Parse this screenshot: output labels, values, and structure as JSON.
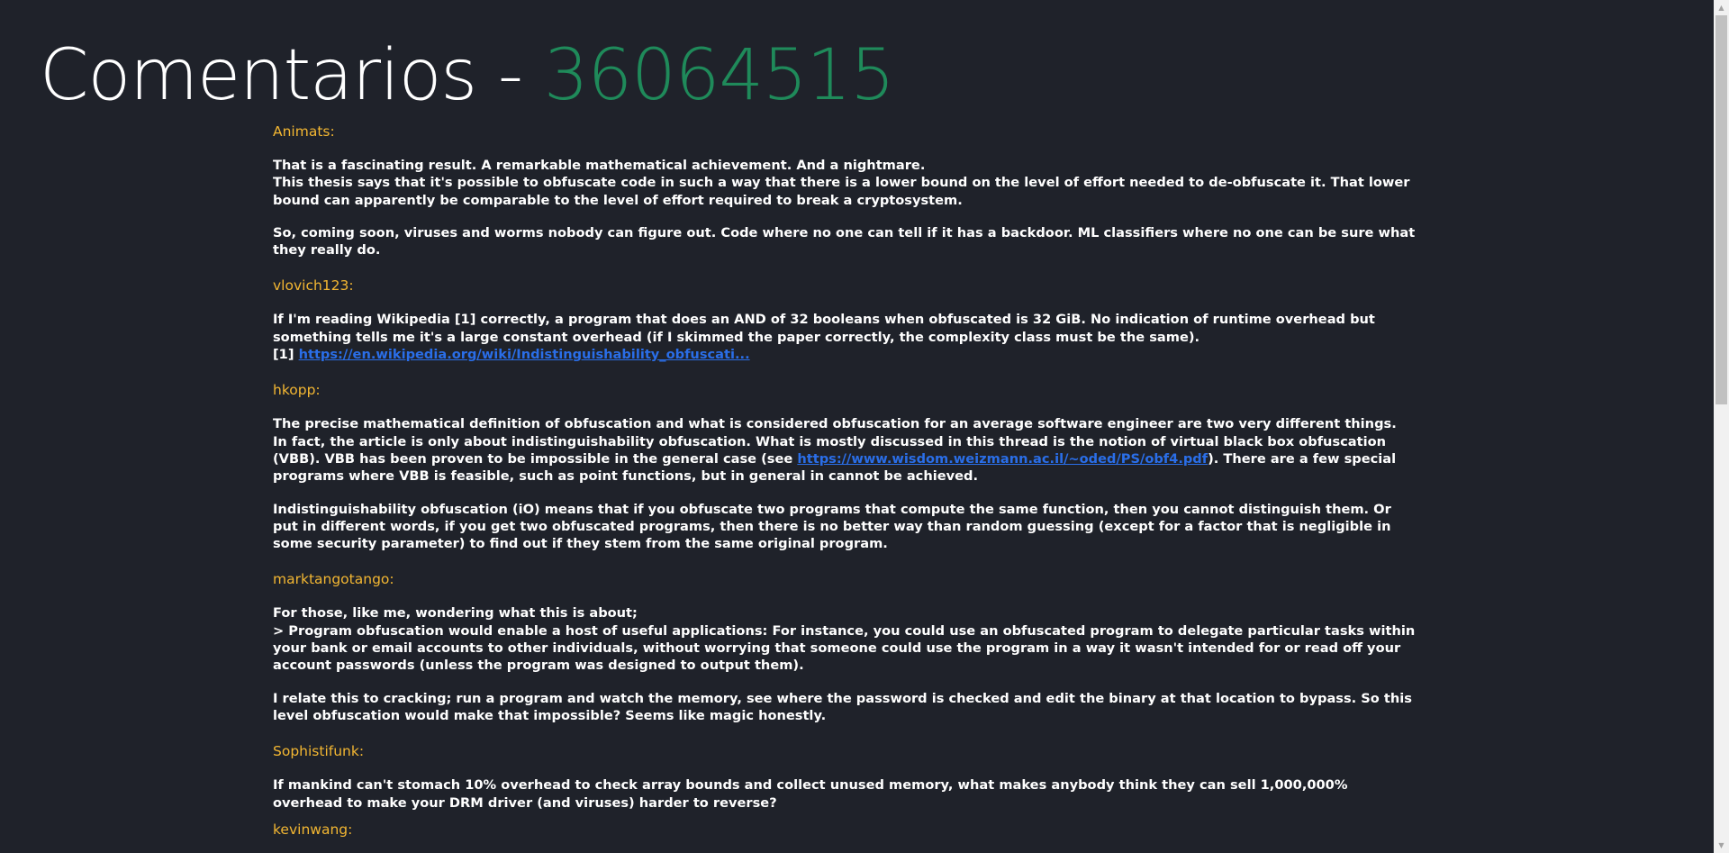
{
  "page": {
    "title_prefix": "Comentarios",
    "title_separator": " - ",
    "title_id": "36064515"
  },
  "comments": [
    {
      "author": "Animats:",
      "paragraphs": [
        "That is a fascinating result. A remarkable mathematical achievement. And a nightmare.\nThis thesis says that it's possible to obfuscate code in such a way that there is a lower bound on the level of effort needed to de-obfuscate it. That lower bound can apparently be comparable to the level of effort required to break a cryptosystem.",
        "So, coming soon, viruses and worms nobody can figure out. Code where no one can tell if it has a backdoor. ML classifiers where no one can be sure what they really do."
      ]
    },
    {
      "author": "vlovich123:",
      "p1": "If I'm reading Wikipedia [1] correctly, a program that does an AND of 32 booleans when obfuscated is 32 GiB. No indication of runtime overhead but something tells me it's a large constant overhead (if I skimmed the paper correctly, the complexity class must be the same).",
      "ref_prefix": "[1] ",
      "link_text": "https://en.wikipedia.org/wiki/Indistinguishability_obfuscati..."
    },
    {
      "author": "hkopp:",
      "p1_a": "The precise mathematical definition of obfuscation and what is considered obfuscation for an average software engineer are two very different things.\nIn fact, the article is only about indistinguishability obfuscation. What is mostly discussed in this thread is the notion of virtual black box obfuscation (VBB). VBB has been proven to be impossible in the general case (see ",
      "link_text": "https://www.wisdom.weizmann.ac.il/~oded/PS/obf4.pdf",
      "p1_b": "). There are a few special programs where VBB is feasible, such as point functions, but in general in cannot be achieved.",
      "p2": "Indistinguishability obfuscation (iO) means that if you obfuscate two programs that compute the same function, then you cannot distinguish them. Or put in different words, if you get two obfuscated programs, then there is no better way than random guessing (except for a factor that is negligible in some security parameter) to find out if they stem from the same original program."
    },
    {
      "author": "marktangotango:",
      "paragraphs": [
        "For those, like me, wondering what this is about;\n> Program obfuscation would enable a host of useful applications: For instance, you could use an obfuscated program to delegate particular tasks within your bank or email accounts to other individuals, without worrying that someone could use the program in a way it wasn't intended for or read off your account passwords (unless the program was designed to output them).",
        "I relate this to cracking; run a program and watch the memory, see where the password is checked and edit the binary at that location to bypass. So this level obfuscation would make that impossible? Seems like magic honestly."
      ]
    },
    {
      "author": "Sophistifunk:",
      "paragraphs": [
        "If mankind can't stomach 10% overhead to check array bounds and collect unused memory, what makes anybody think they can sell 1,000,000% overhead to make your DRM driver (and viruses) harder to reverse?"
      ]
    },
    {
      "author": "kevinwang:"
    }
  ],
  "colors": {
    "background": "#1f222a",
    "author": "#f2b632",
    "title_id": "#1f8a5a",
    "link": "#2a6ee8",
    "text": "#ffffff"
  },
  "icons": {
    "scroll_up": "triangle-up-icon",
    "scroll_down": "triangle-down-icon"
  }
}
